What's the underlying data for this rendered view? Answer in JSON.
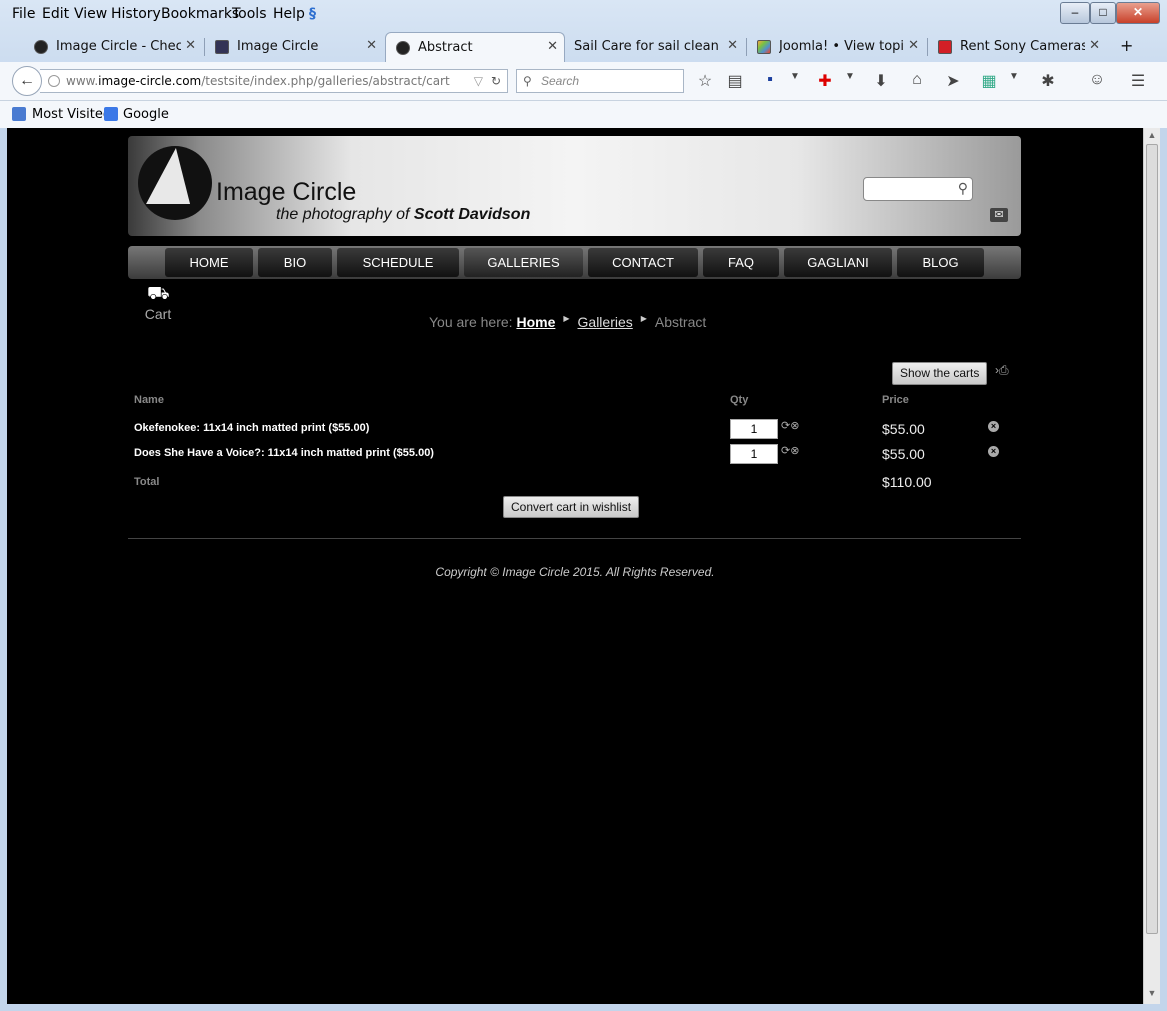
{
  "menubar": {
    "items": [
      "File",
      "Edit",
      "View",
      "History",
      "Bookmarks",
      "Tools",
      "Help"
    ]
  },
  "window_controls": {
    "minimize": "–",
    "maximize": "□",
    "close": "✕"
  },
  "tabs": [
    {
      "title": "Image Circle - Check...",
      "icon": "image-circle-favicon"
    },
    {
      "title": "Image Circle",
      "icon": "image-circle-square-favicon"
    },
    {
      "title": "Abstract",
      "icon": "image-circle-favicon",
      "active": true
    },
    {
      "title": "Sail Care for sail cleaning,...",
      "icon": "none"
    },
    {
      "title": "Joomla! • View topic ...",
      "icon": "joomla-icon"
    },
    {
      "title": "Rent Sony Cameras | ...",
      "icon": "red-icon"
    }
  ],
  "new_tab": "+",
  "tab_close": "✕",
  "urlbar": {
    "prefix": "www.",
    "domain": "image-circle.com",
    "path": "/testsite/index.php/galleries/abstract/cart"
  },
  "searchbar": {
    "placeholder": "Search"
  },
  "bookmarks": [
    "Most Visited",
    "Google"
  ],
  "site": {
    "logo_title": "Image Circle",
    "logo_sub_prefix": "the photography of",
    "logo_sub_name": "Scott Davidson",
    "menu": [
      "HOME",
      "BIO",
      "SCHEDULE",
      "GALLERIES",
      "CONTACT",
      "FAQ",
      "GAGLIANI",
      "BLOG"
    ],
    "active_menu": "GALLERIES",
    "cart_label": "Cart",
    "breadcrumb": {
      "prefix": "You are here:",
      "home": "Home",
      "galleries": "Galleries",
      "current": "Abstract"
    },
    "show_carts": "Show the carts",
    "table": {
      "headers": {
        "name": "Name",
        "qty": "Qty",
        "price": "Price"
      },
      "rows": [
        {
          "name": "Okefenokee: 11x14 inch matted print ($55.00)",
          "qty": "1",
          "price": "$55.00"
        },
        {
          "name": "Does She Have a Voice?: 11x14 inch matted print ($55.00)",
          "qty": "1",
          "price": "$55.00"
        }
      ],
      "total_label": "Total",
      "total_value": "$110.00"
    },
    "wishlist_button": "Convert cart in wishlist",
    "copyright": "Copyright © Image Circle 2015. All Rights Reserved."
  }
}
